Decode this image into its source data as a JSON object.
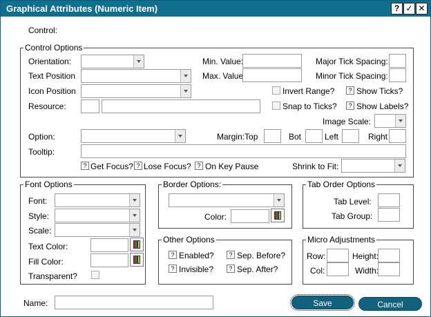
{
  "window": {
    "title": "Graphical Attributes (Numeric Item)",
    "help_label": "?",
    "ok_label": "✓",
    "close_label": "✕"
  },
  "control": {
    "label": "Control:"
  },
  "control_options": {
    "title": "Control Options",
    "orientation_label": "Orientation:",
    "text_position_label": "Text Position",
    "icon_position_label": "Icon Position",
    "resource_label": "Resource:",
    "option_label": "Option:",
    "tooltip_label": "Tooltip:",
    "min_value_label": "Min. Value:",
    "max_value_label": "Max. Value:",
    "major_tick_label": "Major Tick Spacing:",
    "minor_tick_label": "Minor Tick Spacing:",
    "invert_range_label": "Invert Range?",
    "show_ticks_label": "Show Ticks?",
    "snap_to_ticks_label": "Snap to Ticks?",
    "show_labels_label": "Show Labels?",
    "image_scale_label": "Image Scale:",
    "margin_top_label": "Margin:Top",
    "bot_label": "Bot",
    "left_label": "Left",
    "right_label": "Right",
    "get_focus_label": "Get Focus?",
    "lose_focus_label": "Lose Focus?",
    "on_key_pause_label": "On Key Pause",
    "shrink_to_fit_label": "Shrink to Fit:",
    "check_mark": "?"
  },
  "font_options": {
    "title": "Font Options",
    "font_label": "Font:",
    "style_label": "Style:",
    "scale_label": "Scale:",
    "text_color_label": "Text Color:",
    "fill_color_label": "Fill Color:",
    "transparent_label": "Transparent?"
  },
  "border_options": {
    "title": "Border Options:",
    "color_label": "Color:"
  },
  "other_options": {
    "title": "Other Options",
    "enabled_label": "Enabled?",
    "sep_before_label": "Sep. Before?",
    "invisible_label": "Invisible?",
    "sep_after_label": "Sep. After?",
    "check_mark": "?"
  },
  "tab_order_options": {
    "title": "Tab Order Options",
    "tab_level_label": "Tab Level:",
    "tab_group_label": "Tab Group:"
  },
  "micro_adjustments": {
    "title": "Micro Adjustments",
    "row_label": "Row:",
    "height_label": "Height:",
    "col_label": "Col:",
    "width_label": "Width:"
  },
  "footer": {
    "name_label": "Name:",
    "save_label": "Save",
    "cancel_label": "Cancel"
  },
  "colors": {
    "titlebar": "#0f6f8c",
    "button": "#12627d"
  }
}
